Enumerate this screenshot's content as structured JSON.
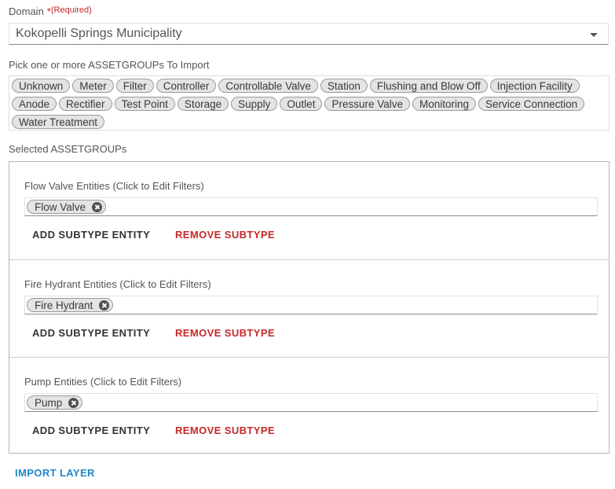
{
  "domain": {
    "label": "Domain",
    "required_star": "*",
    "required_text": "(Required)",
    "value": "Kokopelli Springs Municipality"
  },
  "asset_groups": {
    "label": "Pick one or more ASSETGROUPs To Import",
    "chips": [
      "Unknown",
      "Meter",
      "Filter",
      "Controller",
      "Controllable Valve",
      "Station",
      "Flushing and Blow Off",
      "Injection Facility",
      "Anode",
      "Rectifier",
      "Test Point",
      "Storage",
      "Supply",
      "Outlet",
      "Pressure Valve",
      "Monitoring",
      "Service Connection",
      "Water Treatment"
    ]
  },
  "selected": {
    "label": "Selected ASSETGROUPs",
    "panels": [
      {
        "title": "Flow Valve Entities (Click to Edit Filters)",
        "chip": "Flow Valve",
        "add": "ADD SUBTYPE ENTITY",
        "remove": "REMOVE SUBTYPE"
      },
      {
        "title": "Fire Hydrant Entities (Click to Edit Filters)",
        "chip": "Fire Hydrant",
        "add": "ADD SUBTYPE ENTITY",
        "remove": "REMOVE SUBTYPE"
      },
      {
        "title": "Pump Entities (Click to Edit Filters)",
        "chip": "Pump",
        "add": "ADD SUBTYPE ENTITY",
        "remove": "REMOVE SUBTYPE"
      }
    ]
  },
  "import_button": "IMPORT LAYER",
  "colors": {
    "required": "#c62828",
    "remove": "#c62828",
    "import": "#1e88c8",
    "chip_bg": "#e4e4e4"
  }
}
